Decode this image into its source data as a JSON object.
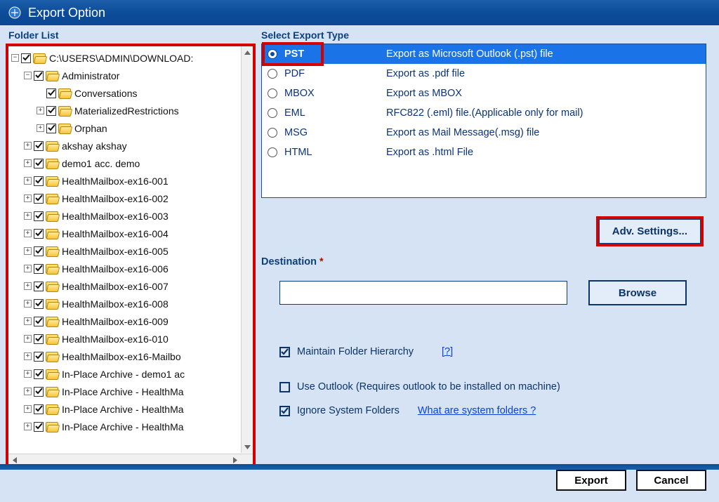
{
  "window": {
    "title": "Export Option"
  },
  "left": {
    "header": "Folder List",
    "root": {
      "label": "C:\\USERS\\ADMIN\\DOWNLOAD:",
      "children": [
        {
          "label": "Administrator",
          "expanded": true,
          "children": [
            {
              "label": "Conversations",
              "plain": true
            },
            {
              "label": "MaterializedRestrictions"
            },
            {
              "label": "Orphan"
            }
          ]
        },
        {
          "label": "akshay akshay"
        },
        {
          "label": "demo1 acc. demo"
        },
        {
          "label": "HealthMailbox-ex16-001"
        },
        {
          "label": "HealthMailbox-ex16-002"
        },
        {
          "label": "HealthMailbox-ex16-003"
        },
        {
          "label": "HealthMailbox-ex16-004"
        },
        {
          "label": "HealthMailbox-ex16-005"
        },
        {
          "label": "HealthMailbox-ex16-006"
        },
        {
          "label": "HealthMailbox-ex16-007"
        },
        {
          "label": "HealthMailbox-ex16-008"
        },
        {
          "label": "HealthMailbox-ex16-009"
        },
        {
          "label": "HealthMailbox-ex16-010"
        },
        {
          "label": "HealthMailbox-ex16-Mailbo"
        },
        {
          "label": "In-Place Archive - demo1 ac"
        },
        {
          "label": "In-Place Archive - HealthMa"
        },
        {
          "label": "In-Place Archive - HealthMa"
        },
        {
          "label": "In-Place Archive - HealthMa"
        }
      ]
    }
  },
  "right": {
    "header": "Select Export Type",
    "types": [
      {
        "code": "PST",
        "desc": "Export as Microsoft Outlook (.pst) file",
        "selected": true
      },
      {
        "code": "PDF",
        "desc": "Export as .pdf file"
      },
      {
        "code": "MBOX",
        "desc": "Export as MBOX"
      },
      {
        "code": "EML",
        "desc": "RFC822 (.eml) file.(Applicable only for mail)"
      },
      {
        "code": "MSG",
        "desc": "Export as Mail Message(.msg) file"
      },
      {
        "code": "HTML",
        "desc": "Export as .html File"
      }
    ],
    "adv_label": "Adv. Settings...",
    "dest_label": "Destination",
    "dest_value": "",
    "browse_label": "Browse",
    "maintain": {
      "label": "Maintain Folder Hierarchy",
      "checked": true,
      "help": "[?]"
    },
    "useoutlook": {
      "label": "Use Outlook (Requires outlook to be installed on machine)",
      "checked": false
    },
    "ignore": {
      "label": "Ignore System Folders",
      "checked": true,
      "help": "What are system folders ?"
    }
  },
  "footer": {
    "export": "Export",
    "cancel": "Cancel"
  }
}
